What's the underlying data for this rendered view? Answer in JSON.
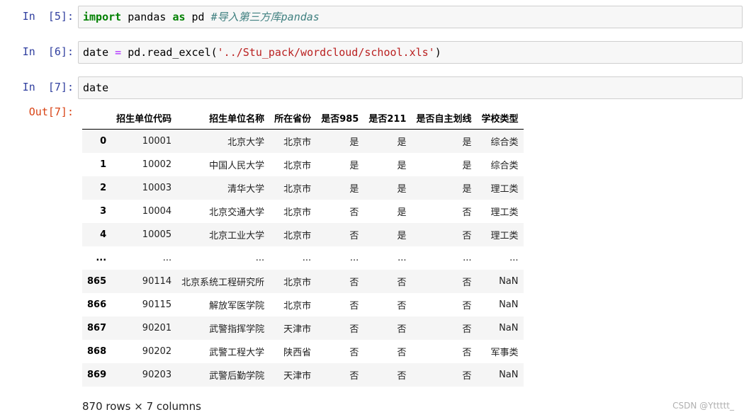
{
  "cells": [
    {
      "prompt": "In  [5]:",
      "tokens": [
        {
          "t": "import",
          "c": "kw"
        },
        {
          "t": " pandas ",
          "c": ""
        },
        {
          "t": "as",
          "c": "kw"
        },
        {
          "t": " pd ",
          "c": ""
        },
        {
          "t": "#导入第三方库pandas",
          "c": "cm"
        }
      ]
    },
    {
      "prompt": "In  [6]:",
      "tokens": [
        {
          "t": "date ",
          "c": ""
        },
        {
          "t": "=",
          "c": "op"
        },
        {
          "t": " pd.read_excel(",
          "c": ""
        },
        {
          "t": "'../Stu_pack/wordcloud/school.xls'",
          "c": "st"
        },
        {
          "t": ")",
          "c": ""
        }
      ]
    },
    {
      "prompt": "In  [7]:",
      "tokens": [
        {
          "t": "date",
          "c": ""
        }
      ]
    }
  ],
  "output": {
    "prompt": "Out[7]:",
    "table": {
      "columns": [
        "",
        "招生单位代码",
        "招生单位名称",
        "所在省份",
        "是否985",
        "是否211",
        "是否自主划线",
        "学校类型"
      ],
      "rows": [
        [
          "0",
          "10001",
          "北京大学",
          "北京市",
          "是",
          "是",
          "是",
          "综合类"
        ],
        [
          "1",
          "10002",
          "中国人民大学",
          "北京市",
          "是",
          "是",
          "是",
          "综合类"
        ],
        [
          "2",
          "10003",
          "清华大学",
          "北京市",
          "是",
          "是",
          "是",
          "理工类"
        ],
        [
          "3",
          "10004",
          "北京交通大学",
          "北京市",
          "否",
          "是",
          "否",
          "理工类"
        ],
        [
          "4",
          "10005",
          "北京工业大学",
          "北京市",
          "否",
          "是",
          "否",
          "理工类"
        ],
        [
          "...",
          "...",
          "...",
          "...",
          "...",
          "...",
          "...",
          "..."
        ],
        [
          "865",
          "90114",
          "北京系统工程研究所",
          "北京市",
          "否",
          "否",
          "否",
          "NaN"
        ],
        [
          "866",
          "90115",
          "解放军医学院",
          "北京市",
          "否",
          "否",
          "否",
          "NaN"
        ],
        [
          "867",
          "90201",
          "武警指挥学院",
          "天津市",
          "否",
          "否",
          "否",
          "NaN"
        ],
        [
          "868",
          "90202",
          "武警工程大学",
          "陕西省",
          "否",
          "否",
          "否",
          "军事类"
        ],
        [
          "869",
          "90203",
          "武警后勤学院",
          "天津市",
          "否",
          "否",
          "否",
          "NaN"
        ]
      ]
    },
    "shape_text": "870 rows × 7 columns"
  },
  "watermark": "CSDN @Yttttt_"
}
